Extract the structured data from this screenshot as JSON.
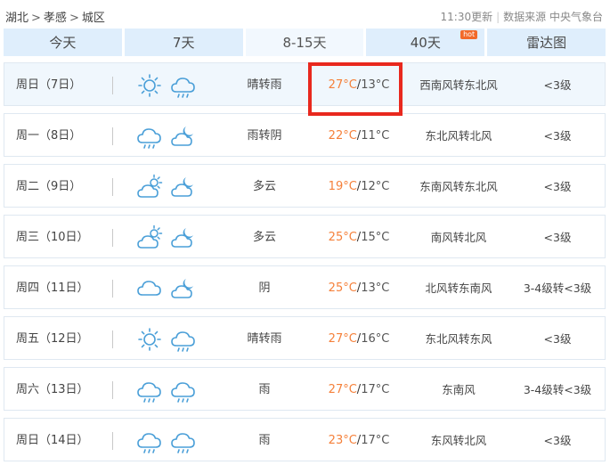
{
  "breadcrumb": {
    "province": "湖北",
    "city": "孝感",
    "district": "城区",
    "separator": ">"
  },
  "meta": {
    "update_time": "11:30更新",
    "divider": "|",
    "source": "数据来源 中央气象台"
  },
  "tabs": [
    {
      "label": "今天",
      "active": false
    },
    {
      "label": "7天",
      "active": false
    },
    {
      "label": "8-15天",
      "active": true
    },
    {
      "label": "40天",
      "active": false,
      "badge": "hot"
    },
    {
      "label": "雷达图",
      "active": false
    }
  ],
  "colors": {
    "tab_bg": "#dfeefc",
    "high_temp": "#f5803a",
    "highlight_box": "#e8281e",
    "hot_badge": "#f26a2a"
  },
  "forecast": [
    {
      "day": "周日（7日）",
      "icons": [
        "sunny-icon",
        "cloud-rain-icon"
      ],
      "weather": "晴转雨",
      "high": "27°C",
      "low": "13°C",
      "wind": "西南风转东北风",
      "level": "<3级"
    },
    {
      "day": "周一（8日）",
      "icons": [
        "cloud-rain-icon",
        "cloud-moon-icon"
      ],
      "weather": "雨转阴",
      "high": "22°C",
      "low": "11°C",
      "wind": "东北风转北风",
      "level": "<3级"
    },
    {
      "day": "周二（9日）",
      "icons": [
        "partly-cloudy-icon",
        "cloud-moon-icon"
      ],
      "weather": "多云",
      "high": "19°C",
      "low": "12°C",
      "wind": "东南风转东北风",
      "level": "<3级"
    },
    {
      "day": "周三（10日）",
      "icons": [
        "partly-cloudy-icon",
        "cloud-moon-icon"
      ],
      "weather": "多云",
      "high": "25°C",
      "low": "15°C",
      "wind": "南风转北风",
      "level": "<3级"
    },
    {
      "day": "周四（11日）",
      "icons": [
        "cloud-icon",
        "cloud-moon-icon"
      ],
      "weather": "阴",
      "high": "25°C",
      "low": "13°C",
      "wind": "北风转东南风",
      "level": "3-4级转<3级"
    },
    {
      "day": "周五（12日）",
      "icons": [
        "sunny-icon",
        "cloud-rain-icon"
      ],
      "weather": "晴转雨",
      "high": "27°C",
      "low": "16°C",
      "wind": "东北风转东风",
      "level": "<3级"
    },
    {
      "day": "周六（13日）",
      "icons": [
        "cloud-rain-icon",
        "cloud-rain-icon"
      ],
      "weather": "雨",
      "high": "27°C",
      "low": "17°C",
      "wind": "东南风",
      "level": "3-4级转<3级"
    },
    {
      "day": "周日（14日）",
      "icons": [
        "cloud-rain-icon",
        "cloud-rain-icon"
      ],
      "weather": "雨",
      "high": "23°C",
      "low": "17°C",
      "wind": "东风转北风",
      "level": "<3级"
    }
  ]
}
